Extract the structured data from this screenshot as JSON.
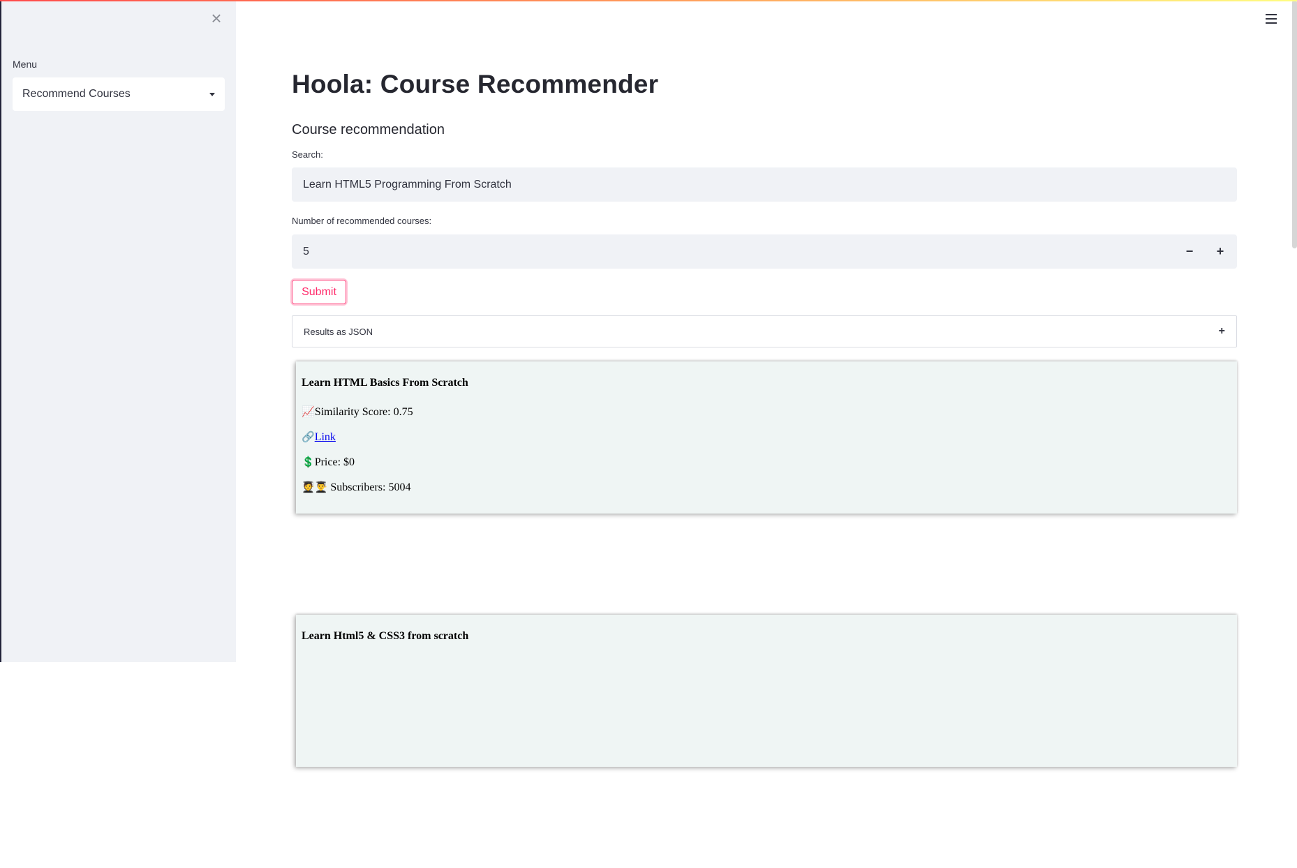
{
  "sidebar": {
    "menu_label": "Menu",
    "menu_selected": "Recommend Courses"
  },
  "main": {
    "title": "Hoola: Course Recommender",
    "section_title": "Course recommendation",
    "search": {
      "label": "Search:",
      "value": "Learn HTML5 Programming From Scratch"
    },
    "number": {
      "label": "Number of recommended courses:",
      "value": "5",
      "minus": "−",
      "plus": "+"
    },
    "submit_label": "Submit",
    "expander": {
      "label": "Results as JSON",
      "toggle": "+"
    }
  },
  "results": [
    {
      "title": "Learn HTML Basics From Scratch",
      "score_label": "Similarity Score: 0.75",
      "link_label": "Link",
      "price_label": "Price: $0",
      "subscribers_label": "Subscribers: 5004"
    },
    {
      "title": "Learn Html5 & CSS3 from scratch"
    }
  ],
  "icons": {
    "chart": "📈",
    "link": "🔗",
    "dollar": "💲",
    "students": "🧑‍🎓👨‍🎓",
    "close": "×"
  },
  "colors": {
    "accent": "#ff2b6b",
    "sidebar_bg": "#f0f2f6",
    "card_bg": "#eff5f4"
  }
}
